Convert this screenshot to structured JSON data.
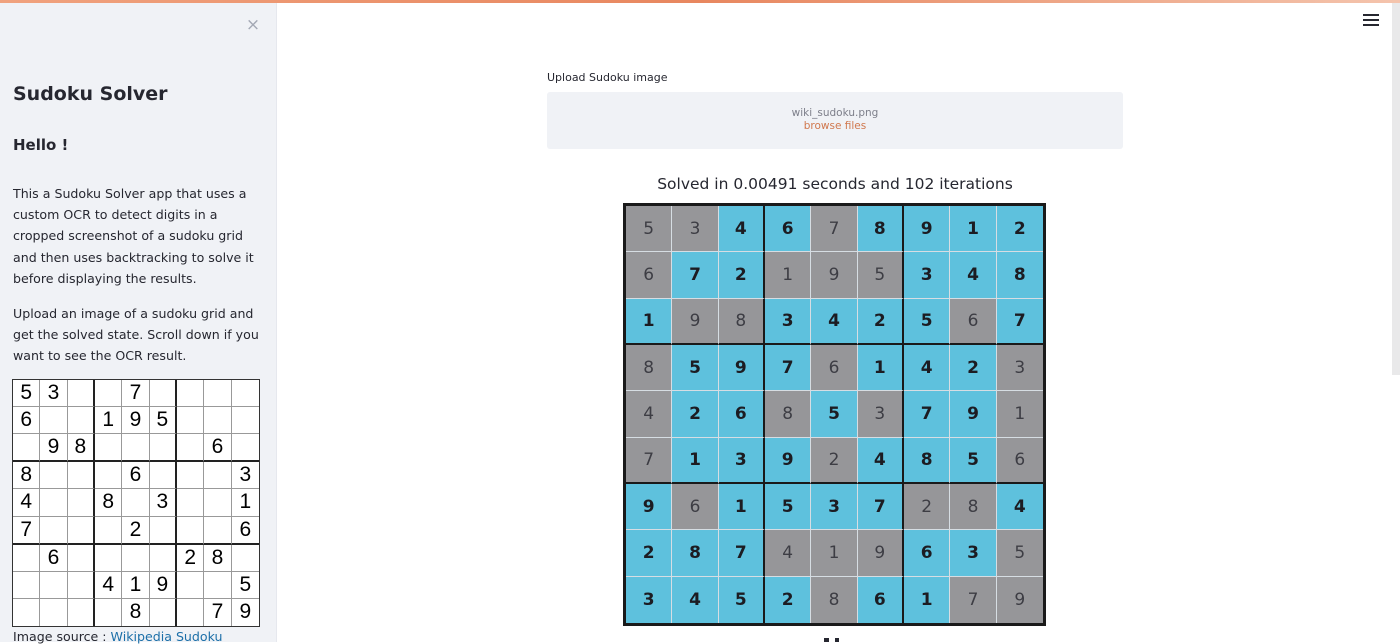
{
  "sidebar": {
    "close_icon": "×",
    "title": "Sudoku Solver",
    "hello": "Hello !",
    "paragraph1": "This a Sudoku Solver app that uses a custom OCR to detect digits in a cropped screenshot of a sudoku grid and then uses backtracking to solve it before displaying the results.",
    "paragraph2": "Upload an image of a sudoku grid and get the solved state. Scroll down if you want to see the OCR result.",
    "source_prefix": "Image source : ",
    "source_link": "Wikipedia Sudoku",
    "original_grid": [
      "53..7....",
      "6..195...",
      ".98....6.",
      "8...6...3",
      "4..8.3..1",
      "7...2...6",
      ".6....28.",
      "...419..5",
      "....8..79"
    ]
  },
  "main": {
    "upload_label": "Upload Sudoku image",
    "file_name": "wiki_sudoku.png",
    "browse_label": "browse files",
    "solved_text": "Solved in 0.00491 seconds and 102 iterations",
    "menu_icon": "hamburger-menu-icon",
    "solved_grid": [
      "534678912",
      "672195348",
      "198342567",
      "859761423",
      "426853791",
      "713924856",
      "961537284",
      "287419635",
      "345286179"
    ]
  },
  "colors": {
    "given_cell": "#969699",
    "solved_cell": "#5ec1dd",
    "accent": "#d0784e",
    "sidebar_bg": "#f0f2f6"
  }
}
